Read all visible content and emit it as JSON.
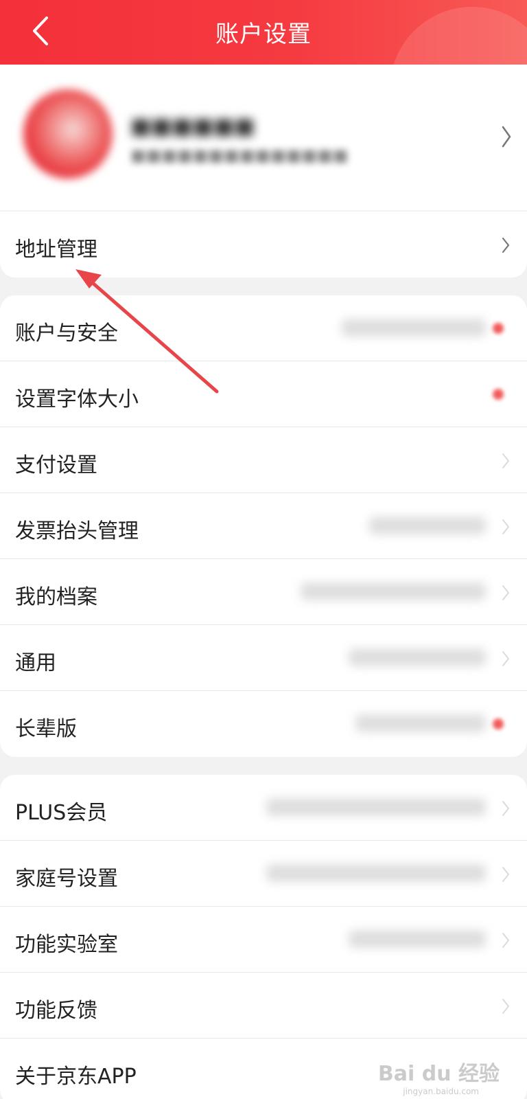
{
  "header": {
    "title": "账户设置",
    "back_icon": "chevron-left-icon",
    "background_color": "#f4303a"
  },
  "address_item": {
    "label": "地址管理"
  },
  "group1": [
    {
      "label": "账户与安全",
      "has_dot": true
    },
    {
      "label": "设置字体大小",
      "has_dot": true
    },
    {
      "label": "支付设置",
      "has_dot": false
    },
    {
      "label": "发票抬头管理",
      "has_dot": false
    },
    {
      "label": "我的档案",
      "has_dot": false
    },
    {
      "label": "通用",
      "has_dot": false
    },
    {
      "label": "长辈版",
      "has_dot": true
    }
  ],
  "group2": [
    {
      "label": "PLUS会员"
    },
    {
      "label": "家庭号设置"
    },
    {
      "label": "功能实验室"
    },
    {
      "label": "功能反馈"
    },
    {
      "label": "关于京东APP"
    }
  ],
  "watermark": {
    "text": "Bai du 经验",
    "sub": "jingyan.baidu.com"
  },
  "colors": {
    "accent": "#f4303a",
    "annotation_arrow": "#e8454a"
  }
}
